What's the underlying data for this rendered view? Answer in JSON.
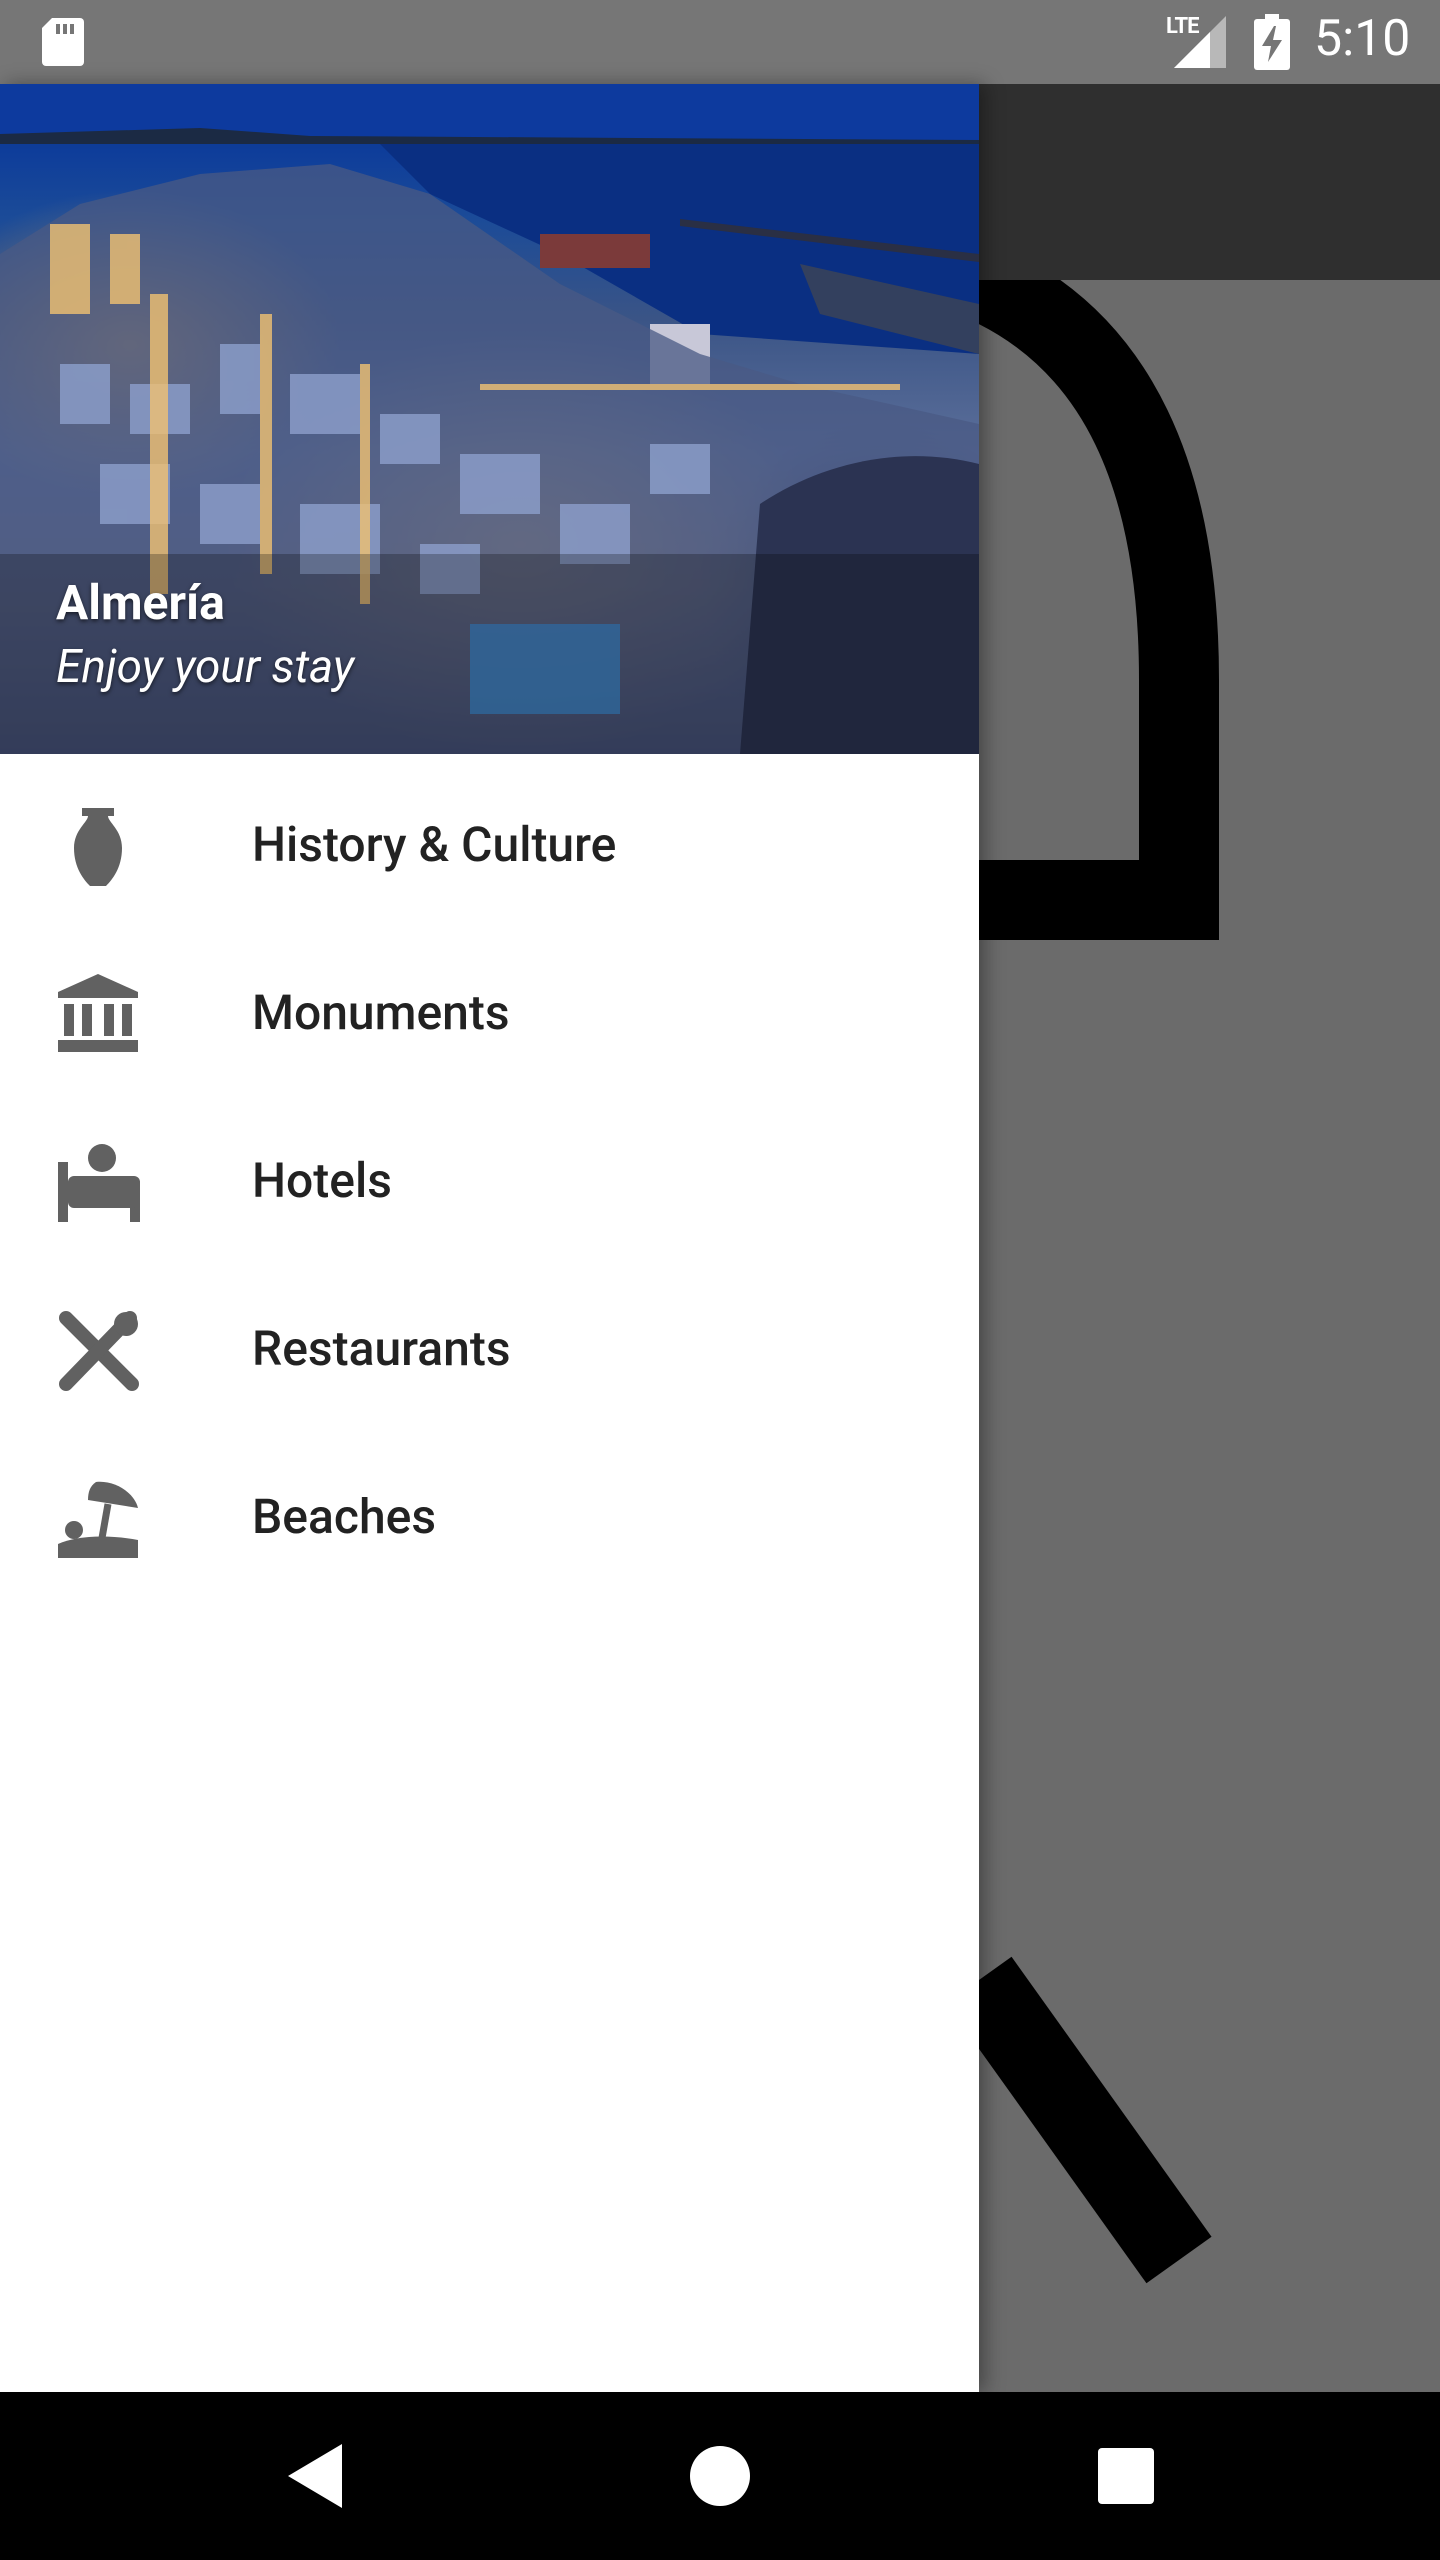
{
  "status_bar": {
    "network": "LTE",
    "time": "5:10"
  },
  "drawer": {
    "header": {
      "title": "Almería",
      "subtitle": "Enjoy your stay"
    },
    "items": [
      {
        "label": "History & Culture",
        "icon": "vase-icon"
      },
      {
        "label": "Monuments",
        "icon": "museum-icon"
      },
      {
        "label": "Hotels",
        "icon": "hotel-bed-icon"
      },
      {
        "label": "Restaurants",
        "icon": "utensils-icon"
      },
      {
        "label": "Beaches",
        "icon": "beach-umbrella-icon"
      }
    ]
  },
  "colors": {
    "icon": "#616161",
    "scrim": "#6b6b6b",
    "toolbar": "#2f2f2f",
    "status_bar": "#767676",
    "nav_bar": "#000000"
  }
}
